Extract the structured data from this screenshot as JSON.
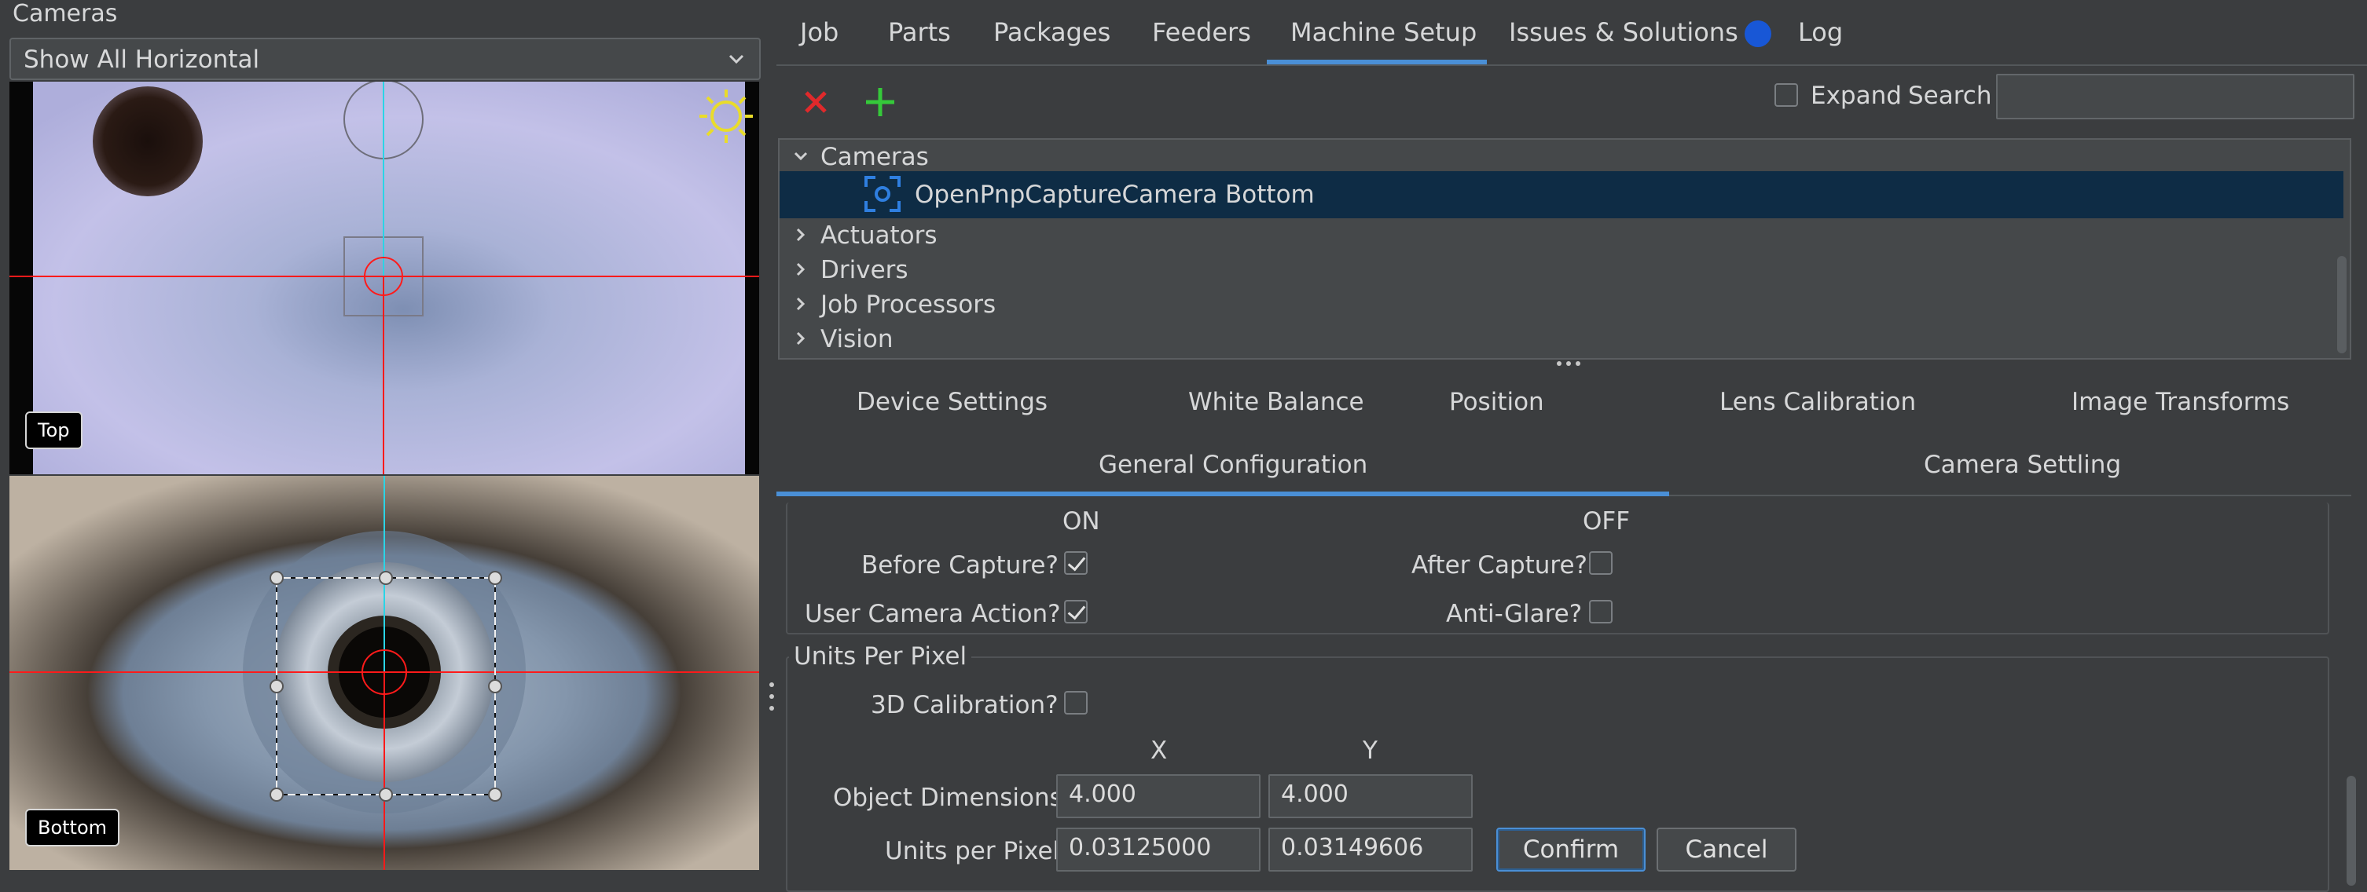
{
  "cameras_panel": {
    "title": "Cameras",
    "view_mode": "Show All Horizontal",
    "top_camera_label": "Top",
    "bottom_camera_label": "Bottom"
  },
  "tabs": [
    {
      "label": "Job"
    },
    {
      "label": "Parts"
    },
    {
      "label": "Packages"
    },
    {
      "label": "Feeders"
    },
    {
      "label": "Machine Setup",
      "active": true
    },
    {
      "label": "Issues & Solutions"
    },
    {
      "label": "Log"
    }
  ],
  "toolbar": {
    "expand_label": "Expand",
    "search_label": "Search",
    "search_value": ""
  },
  "tree": {
    "cameras": "Cameras",
    "selected_camera": "OpenPnpCaptureCamera Bottom",
    "actuators": "Actuators",
    "drivers": "Drivers",
    "job_processors": "Job Processors",
    "vision": "Vision"
  },
  "subtabs_row1": [
    "Device Settings",
    "White Balance",
    "Position",
    "Lens Calibration",
    "Image Transforms"
  ],
  "subtabs_row2": [
    "General Configuration",
    "Camera Settling"
  ],
  "settings": {
    "on_header": "ON",
    "off_header": "OFF",
    "before_capture": "Before Capture?",
    "before_capture_checked": true,
    "after_capture": "After Capture?",
    "after_capture_checked": false,
    "user_camera_action": "User Camera Action?",
    "user_camera_action_checked": true,
    "anti_glare": "Anti-Glare?",
    "anti_glare_checked": false
  },
  "units_per_pixel": {
    "title": "Units Per Pixel",
    "calibration_3d": "3D Calibration?",
    "calibration_3d_checked": false,
    "x_header": "X",
    "y_header": "Y",
    "object_dimensions_label": "Object Dimensions",
    "object_dim_x": "4.000",
    "object_dim_y": "4.000",
    "units_label": "Units per Pixel",
    "units_x": "0.03125000",
    "units_y": "0.03149606",
    "confirm": "Confirm",
    "cancel": "Cancel"
  },
  "colors": {
    "accent": "#4a8fd6",
    "delete_red": "#e0292b",
    "add_green": "#35c93a",
    "issue_dot": "#1857d6",
    "crosshair_red": "#ff1a1a",
    "crosshair_cyan": "#2ad4e6"
  }
}
